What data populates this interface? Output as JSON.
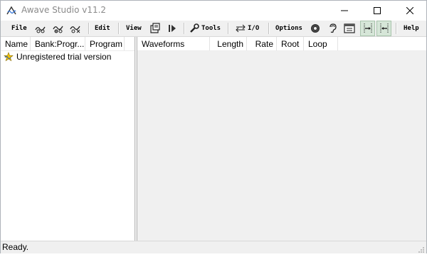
{
  "window": {
    "title": "Awave Studio v11.2"
  },
  "toolbar": {
    "file_label": "File",
    "edit_label": "Edit",
    "view_label": "View",
    "tools_label": "Tools",
    "io_label": "I/O",
    "options_label": "Options",
    "help_label": "Help"
  },
  "left_panel": {
    "columns": [
      "Name",
      "Bank:Progr...",
      "Program"
    ],
    "tree_items": [
      {
        "icon": "star-wave-icon",
        "label": "Unregistered trial version"
      }
    ]
  },
  "right_panel": {
    "columns": [
      "Waveforms",
      "Length",
      "Rate",
      "Root",
      "Loop"
    ]
  },
  "statusbar": {
    "text": "Ready."
  },
  "colors": {
    "toolbar_bg": "#f0f0f0",
    "pane_bg": "#f0f0f0",
    "toggle_bg": "#d6e6d8",
    "title_text": "#8a8a8a"
  }
}
